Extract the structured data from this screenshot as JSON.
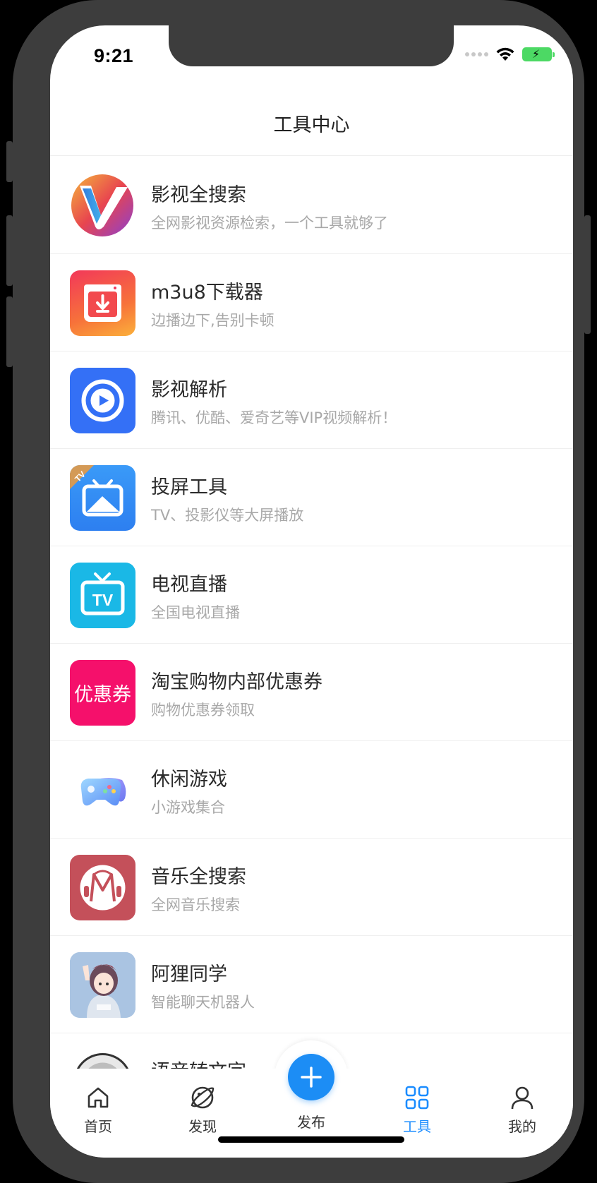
{
  "status": {
    "time": "9:21"
  },
  "header": {
    "title": "工具中心"
  },
  "items": [
    {
      "title": "影视全搜索",
      "subtitle": "全网影视资源检索，一个工具就够了",
      "icon": "v-logo-icon"
    },
    {
      "title": "m3u8下载器",
      "subtitle": "边播边下,告别卡顿",
      "icon": "download-icon"
    },
    {
      "title": "影视解析",
      "subtitle": "腾讯、优酷、爱奇艺等VIP视频解析！",
      "icon": "play-icon"
    },
    {
      "title": "投屏工具",
      "subtitle": "TV、投影仪等大屏播放",
      "icon": "cast-icon",
      "badge": "TV"
    },
    {
      "title": "电视直播",
      "subtitle": "全国电视直播",
      "icon": "tv-icon",
      "icon_text": "TV"
    },
    {
      "title": "淘宝购物内部优惠券",
      "subtitle": "购物优惠券领取",
      "icon": "coupon-icon",
      "icon_text": "优惠券"
    },
    {
      "title": "休闲游戏",
      "subtitle": "小游戏集合",
      "icon": "gamepad-icon"
    },
    {
      "title": "音乐全搜索",
      "subtitle": "全网音乐搜索",
      "icon": "music-icon"
    },
    {
      "title": "阿狸同学",
      "subtitle": "智能聊天机器人",
      "icon": "avatar-icon"
    },
    {
      "title": "语音转文字",
      "subtitle": "",
      "icon": "voice-icon"
    }
  ],
  "tabs": [
    {
      "label": "首页",
      "icon": "home-icon"
    },
    {
      "label": "发现",
      "icon": "planet-icon"
    },
    {
      "label": "发布",
      "icon": "plus-icon"
    },
    {
      "label": "工具",
      "icon": "grid-icon",
      "active": true
    },
    {
      "label": "我的",
      "icon": "user-icon"
    }
  ],
  "colors": {
    "accent": "#1c8df5",
    "active_tab": "#1a8cff"
  }
}
